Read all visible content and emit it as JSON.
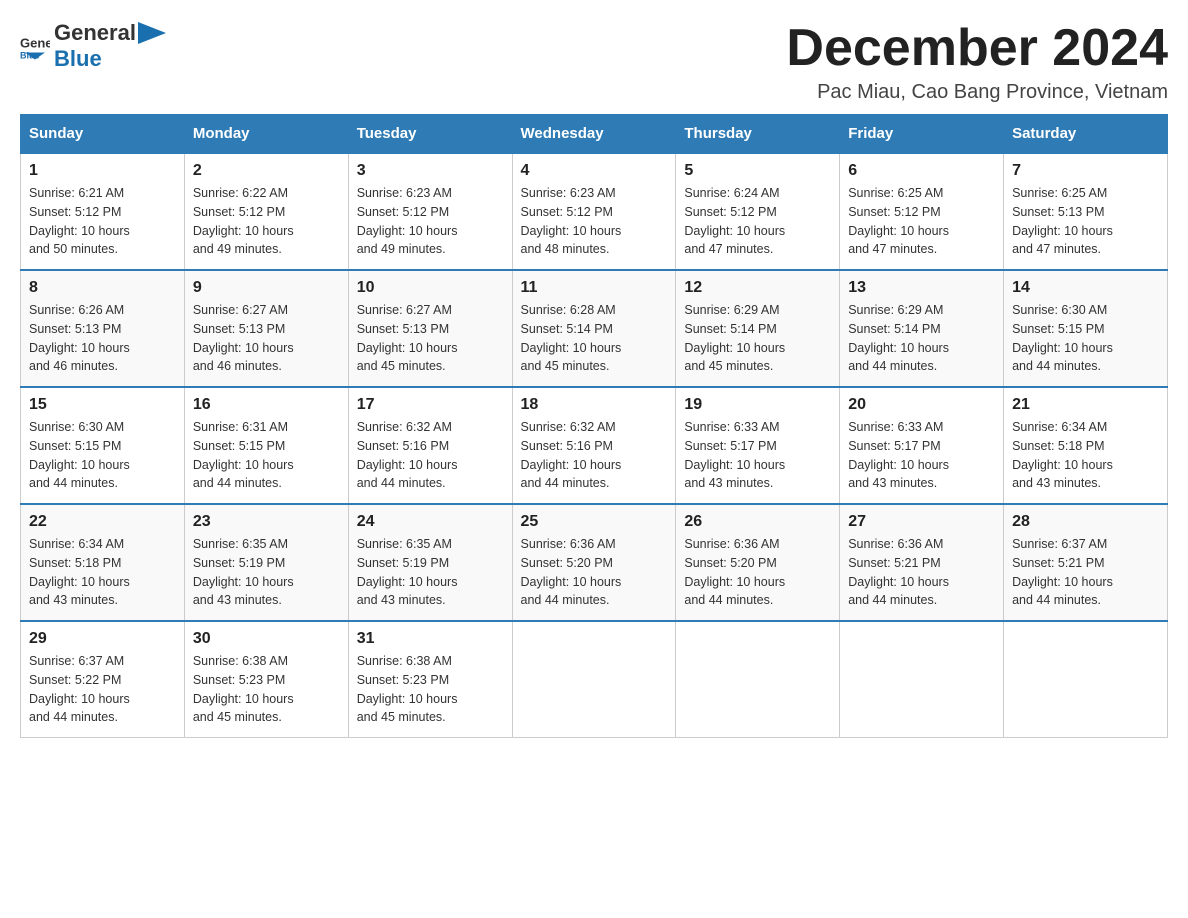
{
  "header": {
    "logo_general": "General",
    "logo_blue": "Blue",
    "month_title": "December 2024",
    "location": "Pac Miau, Cao Bang Province, Vietnam"
  },
  "days_of_week": [
    "Sunday",
    "Monday",
    "Tuesday",
    "Wednesday",
    "Thursday",
    "Friday",
    "Saturday"
  ],
  "weeks": [
    [
      {
        "day": "1",
        "sunrise": "6:21 AM",
        "sunset": "5:12 PM",
        "daylight": "10 hours and 50 minutes."
      },
      {
        "day": "2",
        "sunrise": "6:22 AM",
        "sunset": "5:12 PM",
        "daylight": "10 hours and 49 minutes."
      },
      {
        "day": "3",
        "sunrise": "6:23 AM",
        "sunset": "5:12 PM",
        "daylight": "10 hours and 49 minutes."
      },
      {
        "day": "4",
        "sunrise": "6:23 AM",
        "sunset": "5:12 PM",
        "daylight": "10 hours and 48 minutes."
      },
      {
        "day": "5",
        "sunrise": "6:24 AM",
        "sunset": "5:12 PM",
        "daylight": "10 hours and 47 minutes."
      },
      {
        "day": "6",
        "sunrise": "6:25 AM",
        "sunset": "5:12 PM",
        "daylight": "10 hours and 47 minutes."
      },
      {
        "day": "7",
        "sunrise": "6:25 AM",
        "sunset": "5:13 PM",
        "daylight": "10 hours and 47 minutes."
      }
    ],
    [
      {
        "day": "8",
        "sunrise": "6:26 AM",
        "sunset": "5:13 PM",
        "daylight": "10 hours and 46 minutes."
      },
      {
        "day": "9",
        "sunrise": "6:27 AM",
        "sunset": "5:13 PM",
        "daylight": "10 hours and 46 minutes."
      },
      {
        "day": "10",
        "sunrise": "6:27 AM",
        "sunset": "5:13 PM",
        "daylight": "10 hours and 45 minutes."
      },
      {
        "day": "11",
        "sunrise": "6:28 AM",
        "sunset": "5:14 PM",
        "daylight": "10 hours and 45 minutes."
      },
      {
        "day": "12",
        "sunrise": "6:29 AM",
        "sunset": "5:14 PM",
        "daylight": "10 hours and 45 minutes."
      },
      {
        "day": "13",
        "sunrise": "6:29 AM",
        "sunset": "5:14 PM",
        "daylight": "10 hours and 44 minutes."
      },
      {
        "day": "14",
        "sunrise": "6:30 AM",
        "sunset": "5:15 PM",
        "daylight": "10 hours and 44 minutes."
      }
    ],
    [
      {
        "day": "15",
        "sunrise": "6:30 AM",
        "sunset": "5:15 PM",
        "daylight": "10 hours and 44 minutes."
      },
      {
        "day": "16",
        "sunrise": "6:31 AM",
        "sunset": "5:15 PM",
        "daylight": "10 hours and 44 minutes."
      },
      {
        "day": "17",
        "sunrise": "6:32 AM",
        "sunset": "5:16 PM",
        "daylight": "10 hours and 44 minutes."
      },
      {
        "day": "18",
        "sunrise": "6:32 AM",
        "sunset": "5:16 PM",
        "daylight": "10 hours and 44 minutes."
      },
      {
        "day": "19",
        "sunrise": "6:33 AM",
        "sunset": "5:17 PM",
        "daylight": "10 hours and 43 minutes."
      },
      {
        "day": "20",
        "sunrise": "6:33 AM",
        "sunset": "5:17 PM",
        "daylight": "10 hours and 43 minutes."
      },
      {
        "day": "21",
        "sunrise": "6:34 AM",
        "sunset": "5:18 PM",
        "daylight": "10 hours and 43 minutes."
      }
    ],
    [
      {
        "day": "22",
        "sunrise": "6:34 AM",
        "sunset": "5:18 PM",
        "daylight": "10 hours and 43 minutes."
      },
      {
        "day": "23",
        "sunrise": "6:35 AM",
        "sunset": "5:19 PM",
        "daylight": "10 hours and 43 minutes."
      },
      {
        "day": "24",
        "sunrise": "6:35 AM",
        "sunset": "5:19 PM",
        "daylight": "10 hours and 43 minutes."
      },
      {
        "day": "25",
        "sunrise": "6:36 AM",
        "sunset": "5:20 PM",
        "daylight": "10 hours and 44 minutes."
      },
      {
        "day": "26",
        "sunrise": "6:36 AM",
        "sunset": "5:20 PM",
        "daylight": "10 hours and 44 minutes."
      },
      {
        "day": "27",
        "sunrise": "6:36 AM",
        "sunset": "5:21 PM",
        "daylight": "10 hours and 44 minutes."
      },
      {
        "day": "28",
        "sunrise": "6:37 AM",
        "sunset": "5:21 PM",
        "daylight": "10 hours and 44 minutes."
      }
    ],
    [
      {
        "day": "29",
        "sunrise": "6:37 AM",
        "sunset": "5:22 PM",
        "daylight": "10 hours and 44 minutes."
      },
      {
        "day": "30",
        "sunrise": "6:38 AM",
        "sunset": "5:23 PM",
        "daylight": "10 hours and 45 minutes."
      },
      {
        "day": "31",
        "sunrise": "6:38 AM",
        "sunset": "5:23 PM",
        "daylight": "10 hours and 45 minutes."
      },
      null,
      null,
      null,
      null
    ]
  ],
  "labels": {
    "sunrise": "Sunrise:",
    "sunset": "Sunset:",
    "daylight": "Daylight:"
  }
}
